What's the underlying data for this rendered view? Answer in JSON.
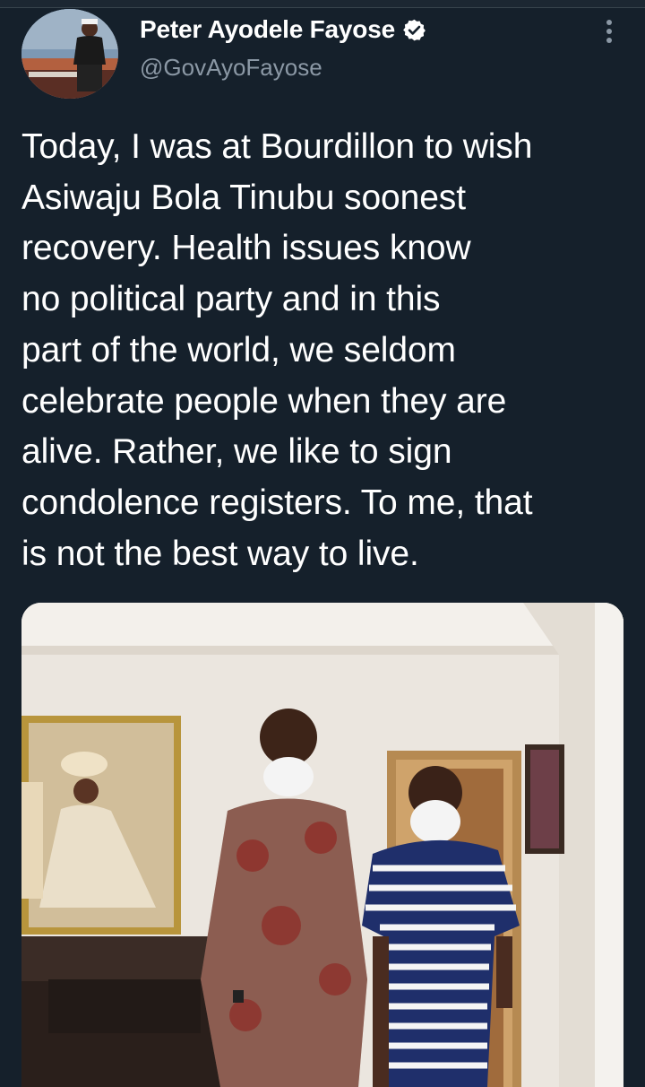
{
  "tweet": {
    "author": {
      "display_name": "Peter Ayodele Fayose",
      "handle": "@GovAyoFayose",
      "verified": true
    },
    "text_lines": [
      "Today, I was at Bourdillon to wish",
      "Asiwaju Bola Tinubu soonest",
      "recovery. Health issues know",
      "no political party and in this",
      "part of the world, we seldom",
      "celebrate people when they are",
      "alive. Rather, we like to sign",
      "condolence registers. To me, that",
      "is not the best way to live."
    ],
    "icons": {
      "more": "more-vertical-icon",
      "verified": "verified-badge-icon"
    }
  },
  "colors": {
    "background": "#15202b",
    "text_primary": "#ffffff",
    "text_secondary": "#8b98a5",
    "verified_fill": "#ffffff",
    "verified_check": "#15202b"
  }
}
